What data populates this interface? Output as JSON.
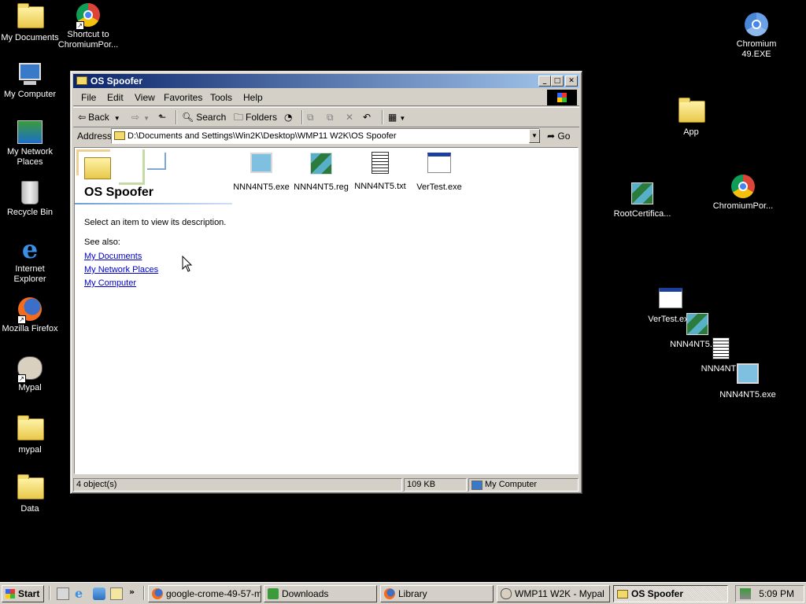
{
  "desktop": {
    "icons": [
      {
        "label": "My Documents"
      },
      {
        "label": "Shortcut to ChromiumPor..."
      },
      {
        "label": "My Computer"
      },
      {
        "label": "My Network Places"
      },
      {
        "label": "Recycle Bin"
      },
      {
        "label": "Internet Explorer"
      },
      {
        "label": "Mozilla Firefox"
      },
      {
        "label": "Mypal"
      },
      {
        "label": "mypal"
      },
      {
        "label": "Data"
      },
      {
        "label": "Chromium 49.EXE"
      },
      {
        "label": "App"
      },
      {
        "label": "RootCertifica..."
      },
      {
        "label": "ChromiumPor..."
      },
      {
        "label": "VerTest.exe"
      },
      {
        "label": "NNN4NT5.reg"
      },
      {
        "label": "NNN4NT5"
      },
      {
        "label": "NNN4NT5.exe"
      }
    ]
  },
  "window": {
    "title": "OS Spoofer",
    "menu": [
      "File",
      "Edit",
      "View",
      "Favorites",
      "Tools",
      "Help"
    ],
    "toolbar": {
      "back": "Back",
      "search": "Search",
      "folders": "Folders"
    },
    "address": {
      "label": "Address",
      "value": "D:\\Documents and Settings\\Win2K\\Desktop\\WMP11 W2K\\OS Spoofer",
      "go": "Go"
    },
    "panel": {
      "title": "OS Spoofer",
      "description": "Select an item to view its description.",
      "see_also": "See also:",
      "links": [
        "My Documents",
        "My Network Places",
        "My Computer"
      ]
    },
    "files": [
      {
        "name": "NNN4NT5.exe",
        "icon": "exe-computer-icon"
      },
      {
        "name": "NNN4NT5.reg",
        "icon": "registry-file-icon"
      },
      {
        "name": "NNN4NT5.txt",
        "icon": "text-file-icon"
      },
      {
        "name": "VerTest.exe",
        "icon": "window-exe-icon"
      }
    ],
    "status": {
      "objects": "4 object(s)",
      "size": "109 KB",
      "zone": "My Computer"
    }
  },
  "taskbar": {
    "start": "Start",
    "tasks": [
      {
        "label": "google-crome-49-57-mb..."
      },
      {
        "label": "Downloads"
      },
      {
        "label": "Library"
      },
      {
        "label": "WMP11 W2K - Mypal"
      },
      {
        "label": "OS Spoofer"
      }
    ],
    "clock": "5:09 PM"
  }
}
